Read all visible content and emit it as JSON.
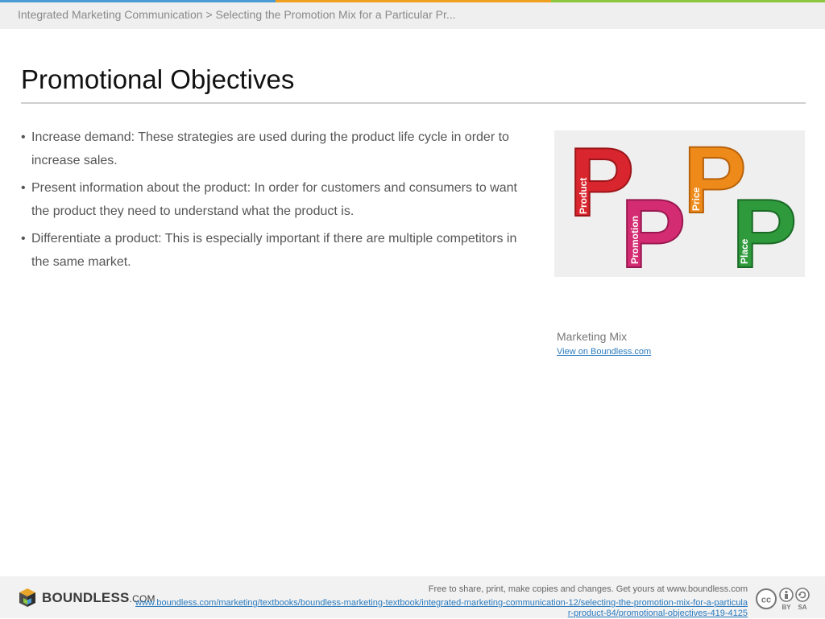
{
  "header": {
    "breadcrumb": "Integrated Marketing Communication > Selecting the Promotion Mix for a Particular Pr..."
  },
  "slide": {
    "title": "Promotional Objectives",
    "bullets": [
      "Increase demand: These strategies are used during the product life cycle in order to increase sales.",
      "Present information about the product: In order for customers and consumers to want the product they need to understand what the product is.",
      "Differentiate a product: This is especially important if there are multiple competitors in the same market."
    ]
  },
  "figure": {
    "letters": [
      {
        "glyph": "P",
        "word": "Product",
        "color": "#d9262e"
      },
      {
        "glyph": "P",
        "word": "Promotion",
        "color": "#d42c73"
      },
      {
        "glyph": "P",
        "word": "Price",
        "color": "#ee8a1a"
      },
      {
        "glyph": "P",
        "word": "Place",
        "color": "#2e9a3c"
      }
    ],
    "caption": "Marketing Mix",
    "link_label": "View on Boundless.com"
  },
  "footer": {
    "logo_name": "BOUNDLESS",
    "logo_suffix": ".COM",
    "free_text": "Free to share, print, make copies and changes. Get yours at www.boundless.com",
    "url": "www.boundless.com/marketing/textbooks/boundless-marketing-textbook/integrated-marketing-communication-12/selecting-the-promotion-mix-for-a-particular-product-84/promotional-objectives-419-4125",
    "license_icons": [
      "creative-commons-icon",
      "attribution-by-icon",
      "share-alike-icon"
    ],
    "license_labels": {
      "by": "BY",
      "sa": "SA"
    }
  }
}
